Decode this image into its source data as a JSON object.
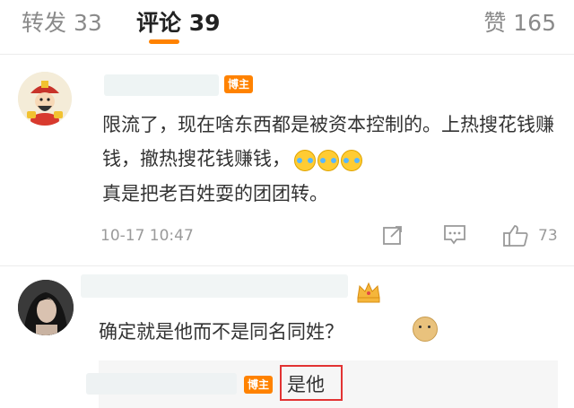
{
  "tabs": {
    "repost": "转发 33",
    "comment": "评论 39",
    "like": "赞 165"
  },
  "accent_color": "#ff8200",
  "comment1": {
    "badge": "博主",
    "text": "限流了，现在啥东西都是被资本控制的。上热搜花钱赚钱，撤热搜花钱赚钱，",
    "text_end": "真是把老百姓耍的团团转。",
    "emoji": [
      "cry-laugh-emoji",
      "cry-laugh-emoji",
      "cry-laugh-emoji"
    ],
    "time": "10-17 10:47",
    "like_count": "73"
  },
  "comment2": {
    "text": "确定就是他而不是同名同姓？",
    "emoji": "doge-emoji"
  },
  "reply": {
    "badge": "博主",
    "text": "是他"
  },
  "highlight_color": "#e23333"
}
